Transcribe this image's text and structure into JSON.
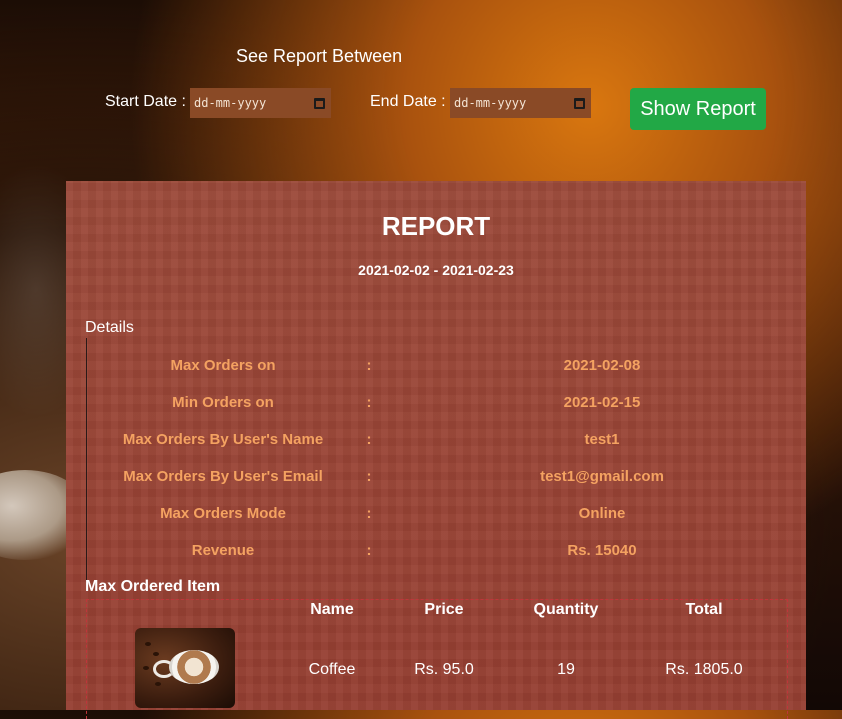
{
  "filter": {
    "title": "See Report Between",
    "start_label": "Start Date :",
    "start_placeholder": "dd-mm-yyyy",
    "end_label": "End Date :",
    "end_placeholder": "dd-mm-yyyy",
    "show_button": "Show Report",
    "button_color": "#22a846"
  },
  "report": {
    "title": "REPORT",
    "range": "2021-02-02 - 2021-02-23",
    "details_legend": "Details",
    "details": [
      {
        "label": "Max Orders on",
        "sep": ":",
        "value": "2021-02-08"
      },
      {
        "label": "Min Orders on",
        "sep": ":",
        "value": "2021-02-15"
      },
      {
        "label": "Max Orders By User's Name",
        "sep": ":",
        "value": "test1"
      },
      {
        "label": "Max Orders By User's Email",
        "sep": ":",
        "value": "test1@gmail.com"
      },
      {
        "label": "Max Orders Mode",
        "sep": ":",
        "value": "Online"
      },
      {
        "label": "Revenue",
        "sep": ":",
        "value": "Rs. 15040"
      }
    ],
    "max_item_legend": "Max Ordered Item",
    "item_table": {
      "headers": [
        "Name",
        "Price",
        "Quantity",
        "Total"
      ],
      "row": {
        "image_icon": "coffee-cup-image",
        "name": "Coffee",
        "price": "Rs. 95.0",
        "quantity": "19",
        "total": "Rs. 1805.0"
      }
    },
    "accent_color": "#f4a261"
  }
}
